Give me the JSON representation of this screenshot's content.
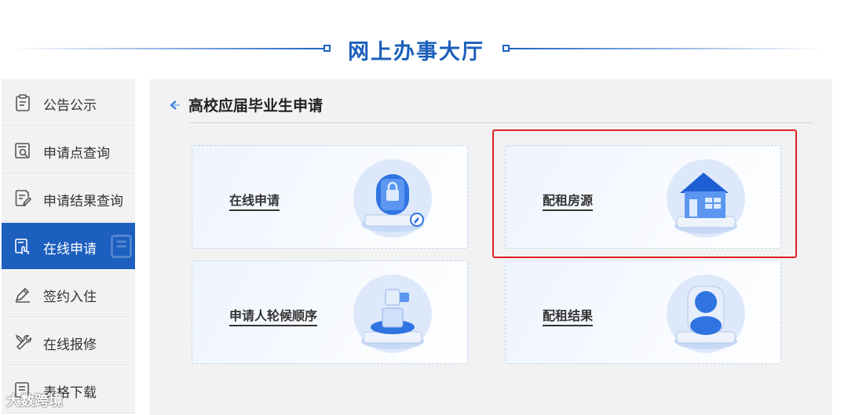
{
  "header": {
    "title": "网上办事大厅"
  },
  "sidebar": {
    "items": [
      {
        "label": "公告公示",
        "icon": "notice-clipboard-icon"
      },
      {
        "label": "申请点查询",
        "icon": "search-document-icon"
      },
      {
        "label": "申请结果查询",
        "icon": "edit-document-icon"
      },
      {
        "label": "在线申请",
        "icon": "hand-click-document-icon",
        "active": true
      },
      {
        "label": "签约入住",
        "icon": "sign-pen-icon"
      },
      {
        "label": "在线报修",
        "icon": "wrench-tools-icon"
      },
      {
        "label": "表格下载",
        "icon": "download-form-icon"
      }
    ]
  },
  "main": {
    "section_title": "高校应届毕业生申请",
    "cards": [
      {
        "label": "在线申请",
        "icon": "lock-device-icon"
      },
      {
        "label": "配租房源",
        "icon": "house-icon",
        "highlighted": true
      },
      {
        "label": "申请人轮候顺序",
        "icon": "stacked-cubes-icon"
      },
      {
        "label": "配租结果",
        "icon": "person-avatar-icon"
      }
    ]
  },
  "watermark": {
    "text": "大数跨境"
  },
  "colors": {
    "accent": "#1d5fbf",
    "highlight": "#e02020",
    "panel": "#f2f2f2"
  }
}
